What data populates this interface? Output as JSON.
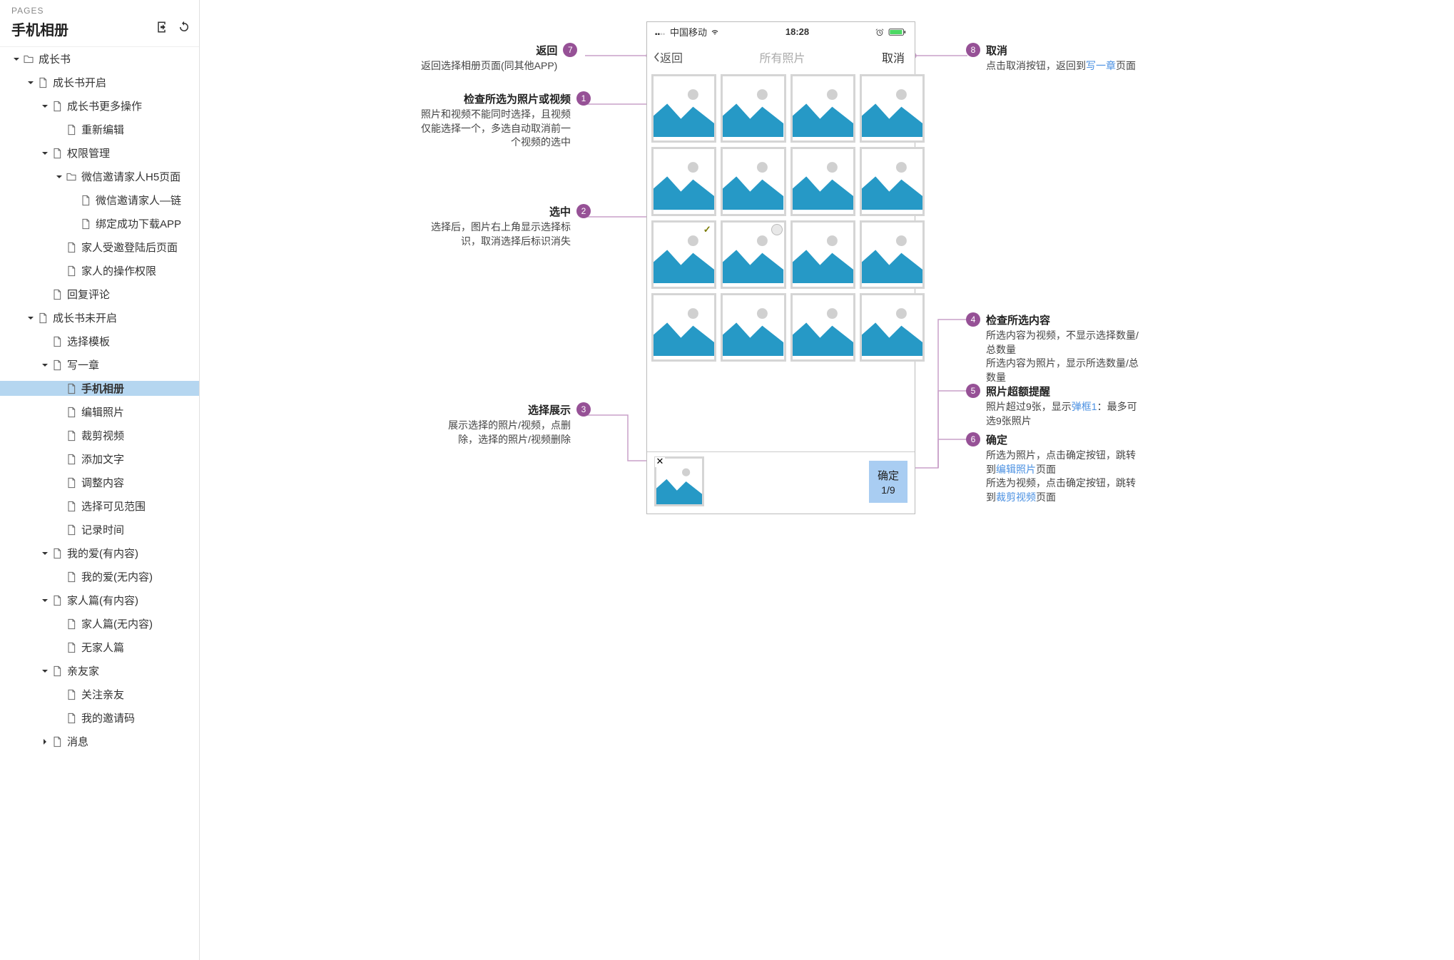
{
  "sidebar": {
    "header": "PAGES",
    "title": "手机相册",
    "tree": [
      {
        "indent": 0,
        "type": "folder",
        "twisty": "down",
        "label": "成长书"
      },
      {
        "indent": 1,
        "type": "page",
        "twisty": "down",
        "label": "成长书开启"
      },
      {
        "indent": 2,
        "type": "page",
        "twisty": "down",
        "label": "成长书更多操作"
      },
      {
        "indent": 3,
        "type": "page",
        "twisty": "none",
        "label": "重新编辑"
      },
      {
        "indent": 2,
        "type": "page",
        "twisty": "down",
        "label": "权限管理"
      },
      {
        "indent": 3,
        "type": "folder",
        "twisty": "down",
        "label": "微信邀请家人H5页面"
      },
      {
        "indent": 4,
        "type": "page",
        "twisty": "none",
        "label": "微信邀请家人—链"
      },
      {
        "indent": 4,
        "type": "page",
        "twisty": "none",
        "label": "绑定成功下载APP"
      },
      {
        "indent": 3,
        "type": "page",
        "twisty": "none",
        "label": "家人受邀登陆后页面"
      },
      {
        "indent": 3,
        "type": "page",
        "twisty": "none",
        "label": "家人的操作权限"
      },
      {
        "indent": 2,
        "type": "page",
        "twisty": "none",
        "label": "回复评论"
      },
      {
        "indent": 1,
        "type": "page",
        "twisty": "down",
        "label": "成长书未开启"
      },
      {
        "indent": 2,
        "type": "page",
        "twisty": "none",
        "label": "选择模板"
      },
      {
        "indent": 2,
        "type": "page",
        "twisty": "down",
        "label": "写一章"
      },
      {
        "indent": 3,
        "type": "page",
        "twisty": "none",
        "label": "手机相册",
        "selected": true
      },
      {
        "indent": 3,
        "type": "page",
        "twisty": "none",
        "label": "编辑照片"
      },
      {
        "indent": 3,
        "type": "page",
        "twisty": "none",
        "label": "裁剪视频"
      },
      {
        "indent": 3,
        "type": "page",
        "twisty": "none",
        "label": "添加文字"
      },
      {
        "indent": 3,
        "type": "page",
        "twisty": "none",
        "label": "调整内容"
      },
      {
        "indent": 3,
        "type": "page",
        "twisty": "none",
        "label": "选择可见范围"
      },
      {
        "indent": 3,
        "type": "page",
        "twisty": "none",
        "label": "记录时间"
      },
      {
        "indent": 2,
        "type": "page",
        "twisty": "down",
        "label": "我的爱(有内容)"
      },
      {
        "indent": 3,
        "type": "page",
        "twisty": "none",
        "label": "我的爱(无内容)"
      },
      {
        "indent": 2,
        "type": "page",
        "twisty": "down",
        "label": "家人篇(有内容)"
      },
      {
        "indent": 3,
        "type": "page",
        "twisty": "none",
        "label": "家人篇(无内容)"
      },
      {
        "indent": 3,
        "type": "page",
        "twisty": "none",
        "label": "无家人篇"
      },
      {
        "indent": 2,
        "type": "page",
        "twisty": "down",
        "label": "亲友家"
      },
      {
        "indent": 3,
        "type": "page",
        "twisty": "none",
        "label": "关注亲友"
      },
      {
        "indent": 3,
        "type": "page",
        "twisty": "none",
        "label": "我的邀请码"
      },
      {
        "indent": 2,
        "type": "page",
        "twisty": "right",
        "label": "消息"
      }
    ]
  },
  "phone": {
    "carrier": "中国移动",
    "time": "18:28",
    "back": "返回",
    "title": "所有照片",
    "cancel": "取消",
    "confirm": "确定",
    "count": "1/9"
  },
  "annotations": {
    "a7": {
      "title": "返回",
      "body": "返回选择相册页面(同其他APP)"
    },
    "a1": {
      "title": "检查所选为照片或视频",
      "body": "照片和视频不能同时选择，且视频仅能选择一个，多选自动取消前一个视频的选中"
    },
    "a2": {
      "title": "选中",
      "body": "选择后，图片右上角显示选择标识，取消选择后标识消失"
    },
    "a3": {
      "title": "选择展示",
      "body": "展示选择的照片/视频，点删除，选择的照片/视频删除"
    },
    "a8": {
      "title": "取消",
      "body_pre": "点击取消按钮，返回到",
      "link": "写一章",
      "body_post": "页面"
    },
    "a4": {
      "title": "检查所选内容",
      "body": "所选内容为视频，不显示选择数量/总数量\n所选内容为照片，显示所选数量/总数量"
    },
    "a5": {
      "title": "照片超额提醒",
      "body_pre": "照片超过9张，显示",
      "link": "弹框1",
      "body_post": "：最多可选9张照片"
    },
    "a6": {
      "title": "确定",
      "line1_pre": "所选为照片，点击确定按钮，跳转到",
      "line1_link": "编辑照片",
      "line1_post": "页面",
      "line2_pre": "所选为视频，点击确定按钮，跳转到",
      "line2_link": "裁剪视频",
      "line2_post": "页面"
    }
  }
}
